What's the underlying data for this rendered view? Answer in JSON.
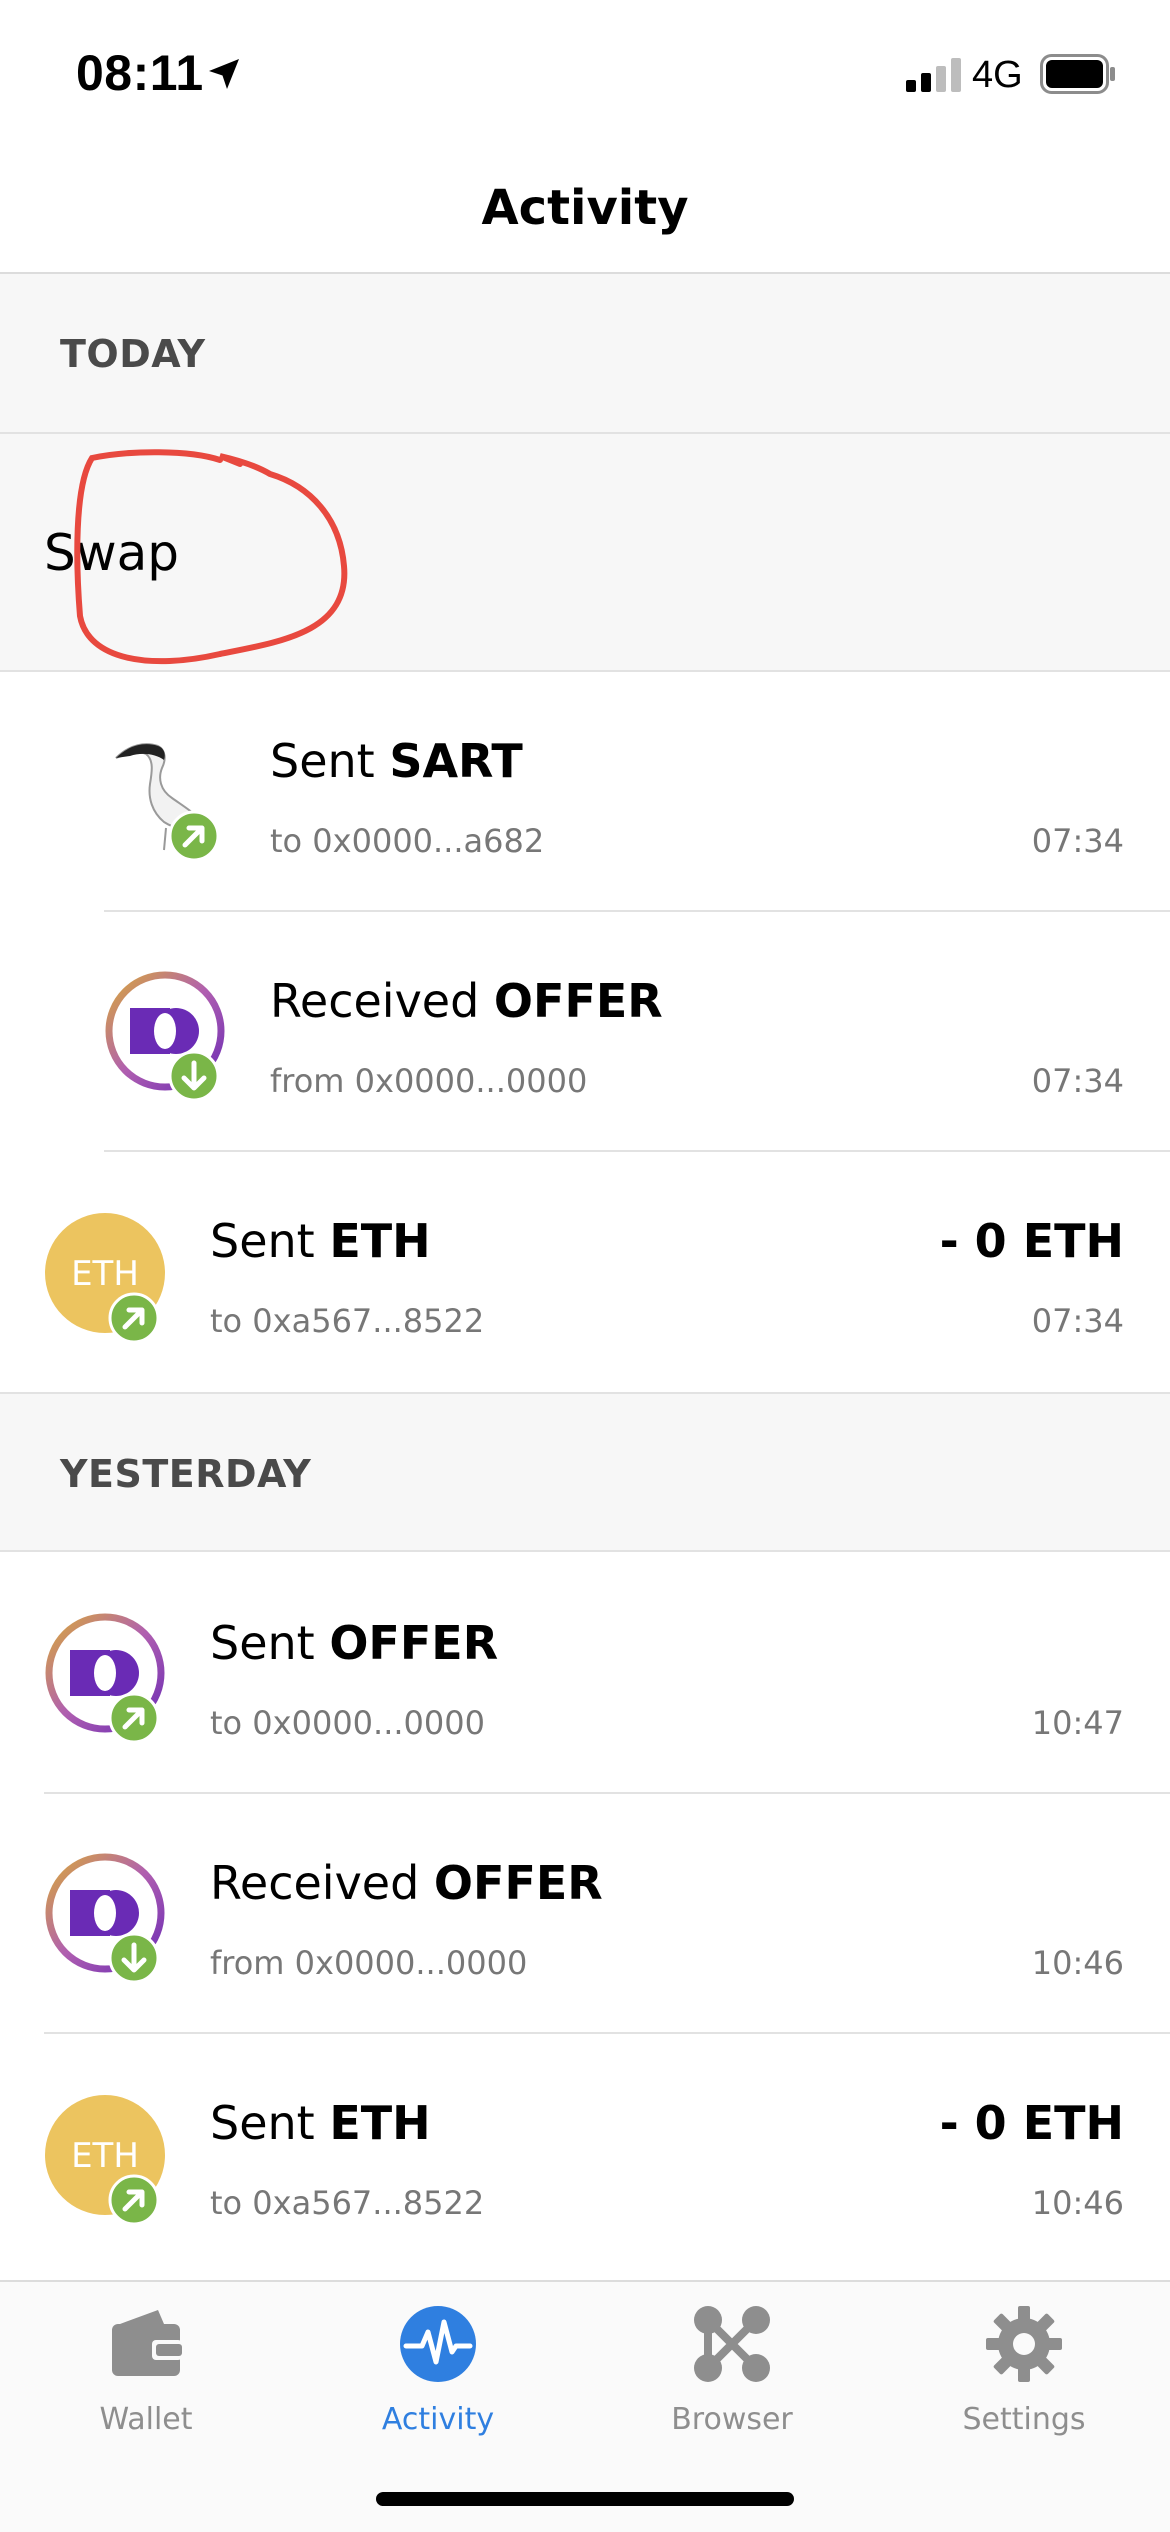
{
  "status_bar": {
    "time": "08:11",
    "network": "4G"
  },
  "nav": {
    "title": "Activity"
  },
  "sections": {
    "today": "TODAY",
    "yesterday": "YESTERDAY"
  },
  "swap": {
    "label": "Swap",
    "annotation_color": "#e8493f"
  },
  "transactions": [
    {
      "verb": "Sent",
      "token": "SART",
      "counterparty": "to 0x0000...a682",
      "amount": "",
      "time": "07:34",
      "direction": "out",
      "icon": "bird-token-icon"
    },
    {
      "verb": "Received",
      "token": "OFFER",
      "counterparty": "from 0x0000...0000",
      "amount": "",
      "time": "07:34",
      "direction": "in",
      "icon": "offer-token-icon"
    },
    {
      "verb": "Sent",
      "token": "ETH",
      "counterparty": "to 0xa567...8522",
      "amount": "- 0 ETH",
      "time": "07:34",
      "direction": "out",
      "icon": "eth-token-icon",
      "icon_text": "ETH"
    },
    {
      "verb": "Sent",
      "token": "OFFER",
      "counterparty": "to 0x0000...0000",
      "amount": "",
      "time": "10:47",
      "direction": "out",
      "icon": "offer-token-icon"
    },
    {
      "verb": "Received",
      "token": "OFFER",
      "counterparty": "from 0x0000...0000",
      "amount": "",
      "time": "10:46",
      "direction": "in",
      "icon": "offer-token-icon"
    },
    {
      "verb": "Sent",
      "token": "ETH",
      "counterparty": "to 0xa567...8522",
      "amount": "- 0 ETH",
      "time": "10:46",
      "direction": "out",
      "icon": "eth-token-icon",
      "icon_text": "ETH"
    }
  ],
  "tabs": [
    {
      "label": "Wallet",
      "icon": "wallet-icon",
      "active": false
    },
    {
      "label": "Activity",
      "icon": "activity-pulse-icon",
      "active": true
    },
    {
      "label": "Browser",
      "icon": "browser-nodes-icon",
      "active": false
    },
    {
      "label": "Settings",
      "icon": "gear-icon",
      "active": false
    }
  ],
  "colors": {
    "accent": "#2f7fe0",
    "badge_green": "#7ab648",
    "eth_gold": "#ecc45f",
    "offer_purple": "#6a2bb5",
    "tab_inactive": "#8e8e8e"
  }
}
